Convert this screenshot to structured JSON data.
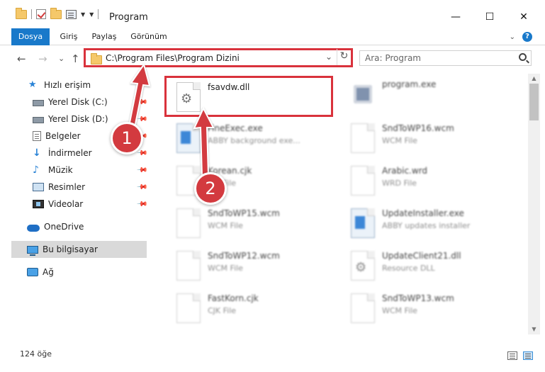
{
  "window": {
    "title": "Program",
    "minimize": "—",
    "maximize": "☐",
    "close": "✕"
  },
  "ribbon": {
    "tabs": [
      "Dosya",
      "Giriş",
      "Paylaş",
      "Görünüm"
    ],
    "expand": "⌄",
    "help": "?"
  },
  "nav": {
    "back": "←",
    "forward": "→",
    "recent": "⌄",
    "up": "↑",
    "address": "C:\\Program Files\\Program Dizini",
    "address_dropdown": "⌄",
    "refresh": "↻",
    "search_placeholder": "Ara: Program"
  },
  "sidebar": {
    "items": [
      {
        "label": "Hızlı erişim",
        "icon": "star-icon"
      },
      {
        "label": "Yerel Disk (C:)",
        "icon": "drive-icon",
        "pinned": true
      },
      {
        "label": "Yerel Disk (D:)",
        "icon": "drive-icon",
        "pinned": true
      },
      {
        "label": "Belgeler",
        "icon": "documents-icon",
        "pinned": true
      },
      {
        "label": "İndirmeler",
        "icon": "downloads-icon",
        "pinned": true
      },
      {
        "label": "Müzik",
        "icon": "music-icon",
        "pinned": true
      },
      {
        "label": "Resimler",
        "icon": "pictures-icon",
        "pinned": true
      },
      {
        "label": "Videolar",
        "icon": "videos-icon",
        "pinned": true
      },
      {
        "label": "OneDrive",
        "icon": "cloud-icon"
      },
      {
        "label": "Bu bilgisayar",
        "icon": "computer-icon",
        "selected": true
      },
      {
        "label": "Ağ",
        "icon": "network-icon"
      }
    ]
  },
  "files": [
    {
      "name": "fsavdw.dll",
      "type": "",
      "icon": "dll-gear"
    },
    {
      "name": "program.exe",
      "type": "",
      "icon": "exe"
    },
    {
      "name": "FineExec.exe",
      "type": "ABBY background exe...",
      "icon": "app"
    },
    {
      "name": "SndToWP16.wcm",
      "type": "WCM File",
      "icon": "blank"
    },
    {
      "name": "Korean.cjk",
      "type": "CJK File",
      "icon": "blank"
    },
    {
      "name": "Arabic.wrd",
      "type": "WRD File",
      "icon": "blank"
    },
    {
      "name": "SndToWP15.wcm",
      "type": "WCM File",
      "icon": "blank"
    },
    {
      "name": "UpdateInstaller.exe",
      "type": "ABBY updates installer",
      "icon": "app"
    },
    {
      "name": "SndToWP12.wcm",
      "type": "WCM File",
      "icon": "blank"
    },
    {
      "name": "UpdateClient21.dll",
      "type": "Resource DLL",
      "icon": "dll-gear"
    },
    {
      "name": "FastKorn.cjk",
      "type": "CJK File",
      "icon": "blank"
    },
    {
      "name": "SndToWP13.wcm",
      "type": "WCM File",
      "icon": "blank"
    }
  ],
  "status": {
    "count": "124 öğe"
  },
  "callouts": [
    "1",
    "2"
  ],
  "colors": {
    "accent": "#1979ca",
    "highlight": "#d9323c",
    "badge": "#d33a3f"
  }
}
